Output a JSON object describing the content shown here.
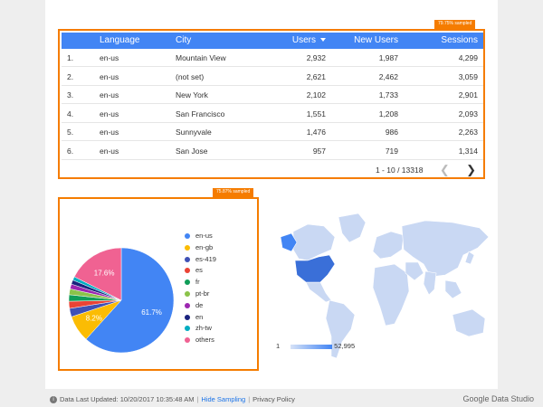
{
  "table": {
    "sampled_badge": "79.75% sampled",
    "headers": {
      "language": "Language",
      "city": "City",
      "users": "Users",
      "new_users": "New Users",
      "sessions": "Sessions"
    },
    "rows": [
      {
        "idx": "1.",
        "language": "en-us",
        "city": "Mountain View",
        "users": "2,932",
        "new_users": "1,987",
        "sessions": "4,299"
      },
      {
        "idx": "2.",
        "language": "en-us",
        "city": "(not set)",
        "users": "2,621",
        "new_users": "2,462",
        "sessions": "3,059"
      },
      {
        "idx": "3.",
        "language": "en-us",
        "city": "New York",
        "users": "2,102",
        "new_users": "1,733",
        "sessions": "2,901"
      },
      {
        "idx": "4.",
        "language": "en-us",
        "city": "San Francisco",
        "users": "1,551",
        "new_users": "1,208",
        "sessions": "2,093"
      },
      {
        "idx": "5.",
        "language": "en-us",
        "city": "Sunnyvale",
        "users": "1,476",
        "new_users": "986",
        "sessions": "2,263"
      },
      {
        "idx": "6.",
        "language": "en-us",
        "city": "San Jose",
        "users": "957",
        "new_users": "719",
        "sessions": "1,314"
      }
    ],
    "pagination": "1 - 10 / 13318",
    "prev_icon": "chevron-left-icon",
    "next_icon": "chevron-right-icon"
  },
  "pie": {
    "sampled_badge": "75.87% sampled"
  },
  "chart_data": {
    "type": "pie",
    "labels": [
      "en-us",
      "en-gb",
      "es-419",
      "es",
      "fr",
      "pt-br",
      "de",
      "en",
      "zh-tw",
      "others"
    ],
    "values": [
      61.7,
      8.2,
      2.6,
      2.2,
      2.0,
      1.8,
      1.5,
      1.3,
      1.1,
      17.6
    ],
    "data_labels": [
      "61.7%",
      "8.2%",
      "",
      "",
      "",
      "",
      "",
      "",
      "",
      "17.6%"
    ],
    "colors": [
      "#4285f4",
      "#fbbc04",
      "#3f51b5",
      "#ea4335",
      "#0f9d58",
      "#8bc34a",
      "#9c27b0",
      "#1a237e",
      "#00acc1",
      "#f06292"
    ],
    "legend_position": "right"
  },
  "map": {
    "legend_min": "1",
    "legend_max": "52,995",
    "low_color": "#d6e2f7",
    "high_color": "#4285f4"
  },
  "footer": {
    "last_updated": "Data Last Updated: 10/20/2017 10:35:48 AM",
    "hide_sampling": "Hide Sampling",
    "privacy": "Privacy Policy",
    "brand": "Google Data Studio"
  }
}
